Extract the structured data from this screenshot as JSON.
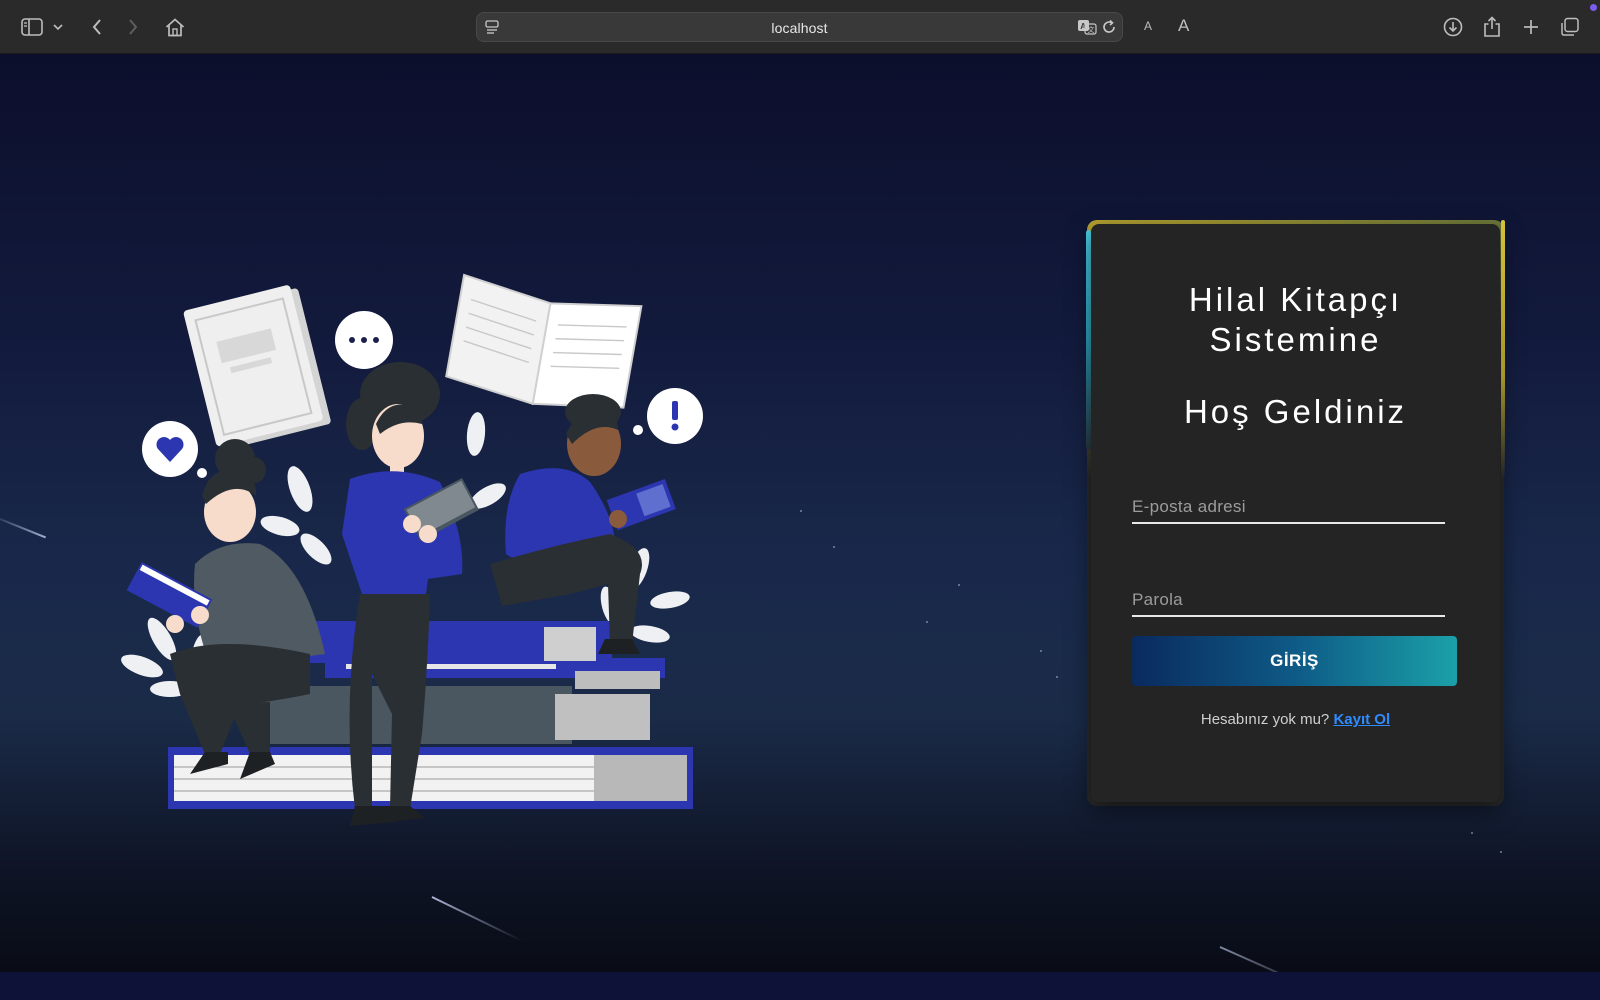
{
  "browser": {
    "url": "localhost",
    "font_small_label": "A",
    "font_large_label": "A",
    "icons": {
      "sidebar": "sidebar-icon",
      "tab_menu": "chevron-down-icon",
      "back": "chevron-left-icon",
      "forward": "chevron-right-icon",
      "home": "home-icon",
      "page_menu": "page-menu-icon",
      "translate": "translate-icon",
      "reload": "reload-icon",
      "download": "download-icon",
      "share": "share-icon",
      "new_tab": "plus-icon",
      "tabs": "tabs-overview-icon"
    }
  },
  "login": {
    "title_line1": "Hilal Kitapçı",
    "title_line2": "Sistemine",
    "subtitle": "Hoş Geldiniz",
    "email_placeholder": "E-posta adresi",
    "password_placeholder": "Parola",
    "submit_label": "GİRİŞ",
    "signup_prompt": "Hesabınız yok mu?",
    "signup_link": "Kayıt Ol"
  },
  "colors": {
    "page_background": "#141b3d",
    "card_background": "#242424",
    "button_gradient_start": "#0a2a5e",
    "button_gradient_end": "#1ba0a8",
    "link": "#2f8cff",
    "illustration_accent": "#2b36b0"
  }
}
